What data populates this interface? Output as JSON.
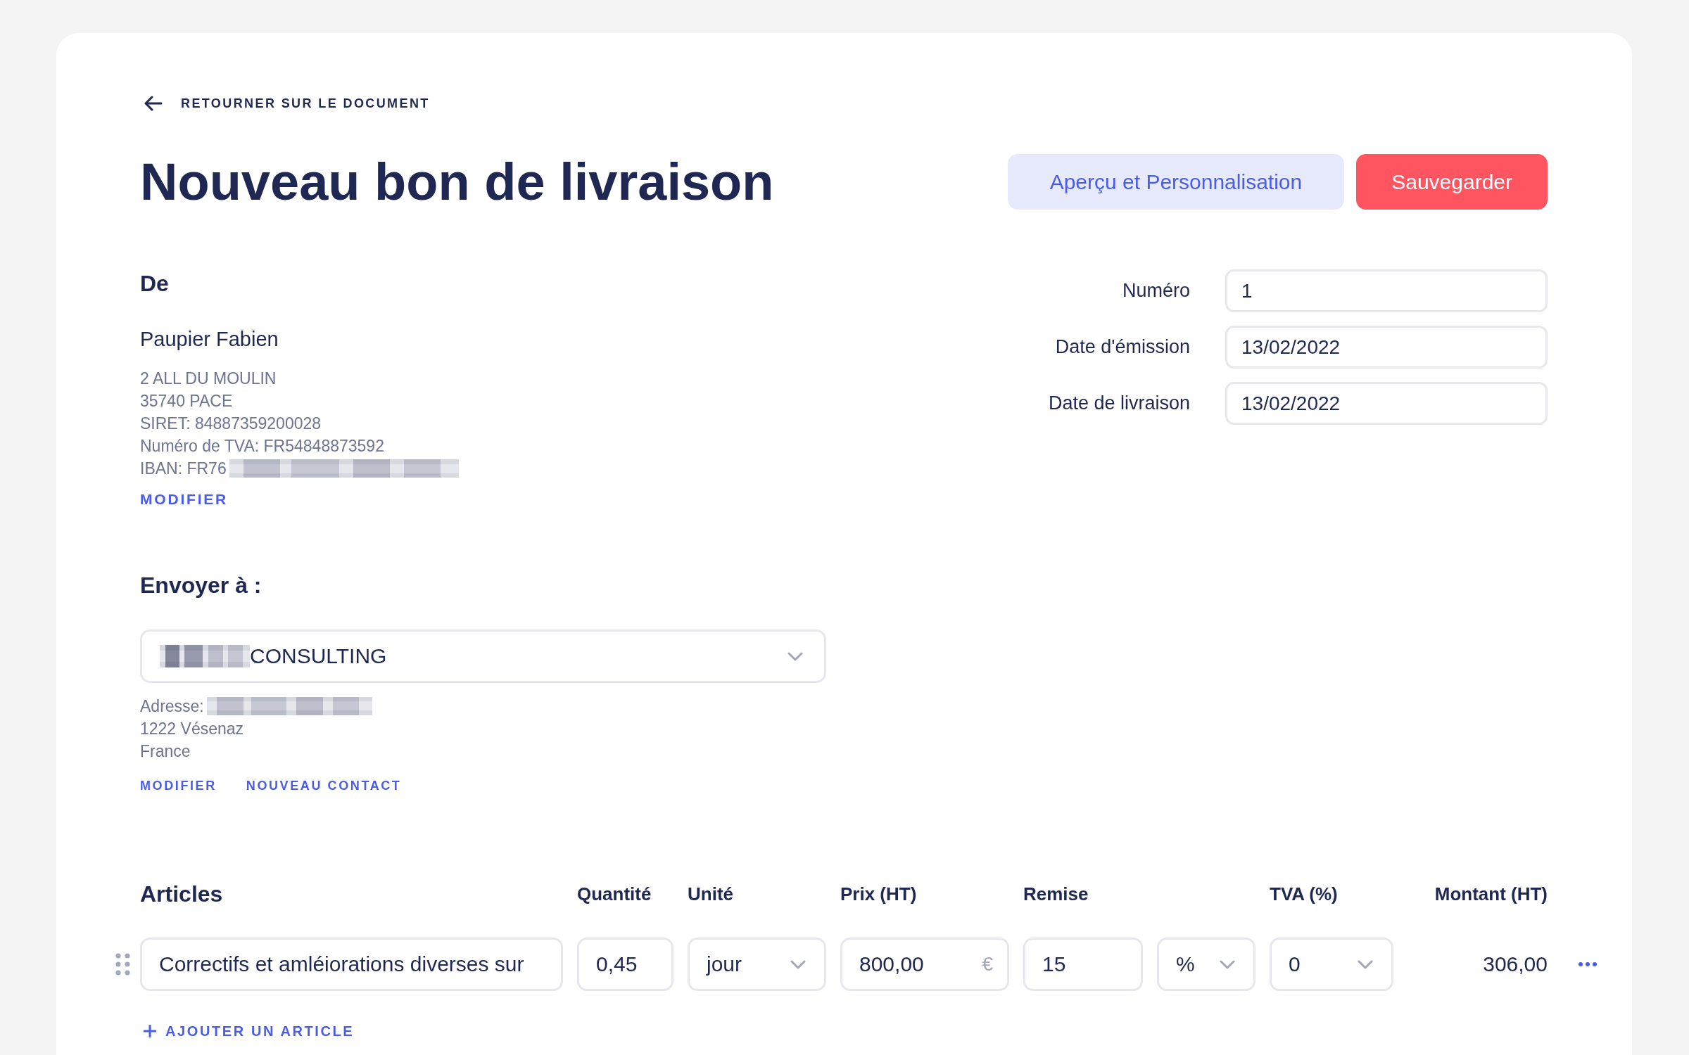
{
  "back_link": "RETOURNER SUR LE DOCUMENT",
  "title": "Nouveau bon de livraison",
  "actions": [
    {
      "label": "Aperçu et Personnalisation",
      "kind": "secondary"
    },
    {
      "label": "Sauvegarder",
      "kind": "primary"
    }
  ],
  "sender": {
    "heading": "De",
    "name": "Paupier Fabien",
    "address_lines": [
      {
        "text": "2 ALL DU MOULIN",
        "masked": false
      },
      {
        "text": "35740 PACE",
        "masked": false
      },
      {
        "text": "SIRET: 84887359200028",
        "masked": false
      },
      {
        "text": "Numéro de TVA: FR54848873592",
        "masked": false
      },
      {
        "text": "IBAN: FR76",
        "masked": true
      }
    ],
    "links": [
      "MODIFIER"
    ]
  },
  "document_fields": [
    {
      "label": "Numéro",
      "value": "1"
    },
    {
      "label": "Date d'émission",
      "value": "13/02/2022"
    },
    {
      "label": "Date de livraison",
      "value": "13/02/2022"
    }
  ],
  "recipient": {
    "heading": "Envoyer à :",
    "contact_select": {
      "value": "CONSULTING",
      "masked": true
    },
    "address_lines": [
      {
        "text": "Adresse:",
        "masked": true
      },
      {
        "text": "1222 Vésenaz",
        "masked": false
      },
      {
        "text": "France",
        "masked": false
      }
    ],
    "links": [
      "MODIFIER",
      "NOUVEAU CONTACT"
    ]
  },
  "articles": {
    "heading": "Articles",
    "columns": [
      "Quantité",
      "Unité",
      "Prix (HT)",
      "Remise",
      "TVA (%)",
      "Montant (HT)"
    ],
    "rows": [
      {
        "description": "Correctifs et amléiorations diverses sur",
        "quantity": "0,45",
        "unit": "jour",
        "price": "800,00",
        "currency": "€",
        "discount": "15",
        "discount_type": "%",
        "vat": "0",
        "amount": "306,00"
      }
    ],
    "add_link": "AJOUTER UN ARTICLE"
  }
}
